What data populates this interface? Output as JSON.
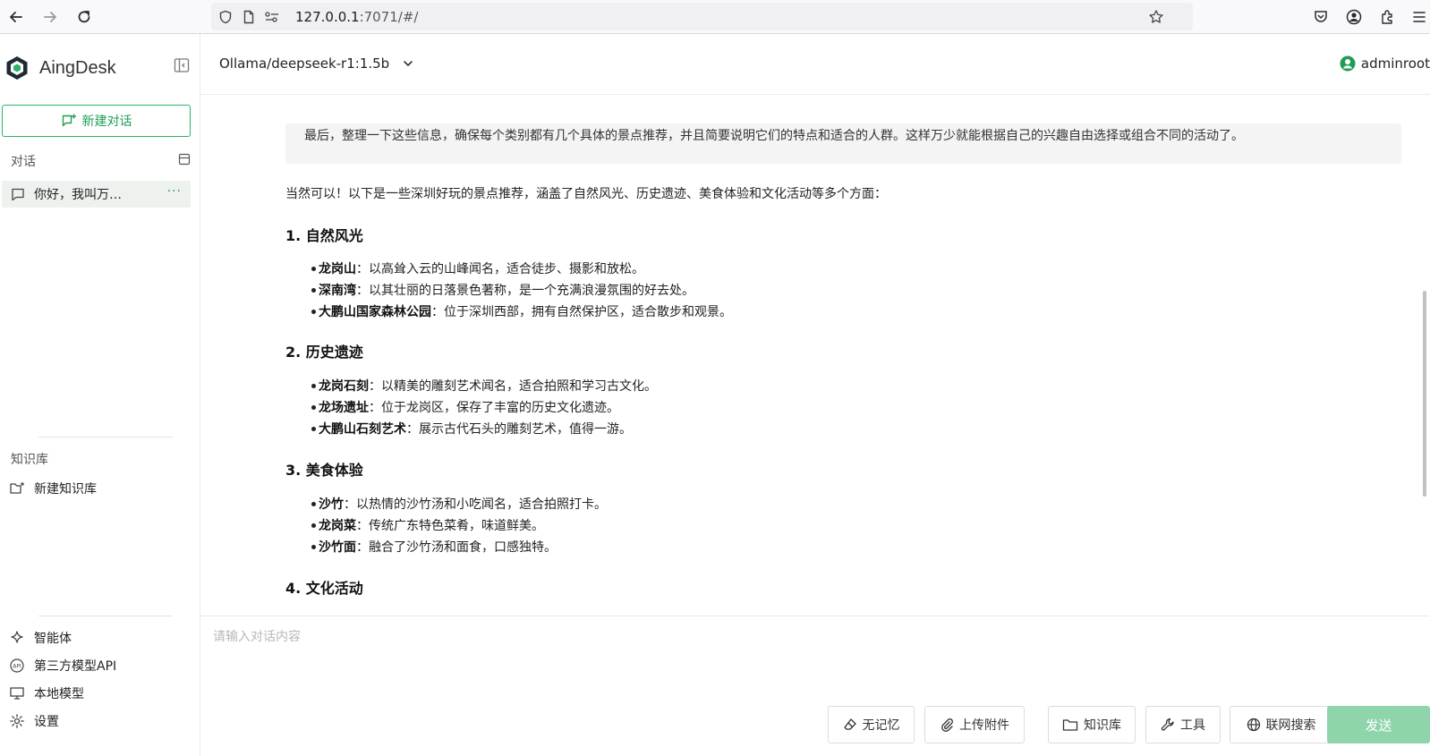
{
  "browser": {
    "url_host": "127.0.0.1",
    "url_rest": ":7071/#/"
  },
  "sidebar": {
    "brand": "AingDesk",
    "new_chat": "新建对话",
    "conversations_label": "对话",
    "conversations": [
      {
        "title": "你好，我叫万…",
        "more": "···"
      }
    ],
    "knowledge_label": "知识库",
    "new_knowledge": "新建知识库",
    "bottom_links": [
      {
        "label": "智能体",
        "icon": "sparkle-icon"
      },
      {
        "label": "第三方模型API",
        "icon": "api-icon"
      },
      {
        "label": "本地模型",
        "icon": "monitor-icon"
      },
      {
        "label": "设置",
        "icon": "gear-icon"
      }
    ]
  },
  "topbar": {
    "model": "Ollama/deepseek-r1:1.5b",
    "user": "adminroot"
  },
  "chat": {
    "thinking": "最后，整理一下这些信息，确保每个类别都有几个具体的景点推荐，并且简要说明它们的特点和适合的人群。这样万少就能根据自己的兴趣自由选择或组合不同的活动了。",
    "intro": "当然可以！以下是一些深圳好玩的景点推荐，涵盖了自然风光、历史遗迹、美食体验和文化活动等多个方面：",
    "sections": [
      {
        "heading": "1. 自然风光",
        "items": [
          {
            "name": "龙岗山",
            "desc": "：以高耸入云的山峰闻名，适合徒步、摄影和放松。"
          },
          {
            "name": "深南湾",
            "desc": "：以其壮丽的日落景色著称，是一个充满浪漫氛围的好去处。"
          },
          {
            "name": "大鹏山国家森林公园",
            "desc": "：位于深圳西部，拥有自然保护区，适合散步和观景。"
          }
        ]
      },
      {
        "heading": "2. 历史遗迹",
        "items": [
          {
            "name": "龙岗石刻",
            "desc": "：以精美的雕刻艺术闻名，适合拍照和学习古文化。"
          },
          {
            "name": "龙场遗址",
            "desc": "：位于龙岗区，保存了丰富的历史文化遗迹。"
          },
          {
            "name": "大鹏山石刻艺术",
            "desc": "：展示古代石头的雕刻艺术，值得一游。"
          }
        ]
      },
      {
        "heading": "3. 美食体验",
        "items": [
          {
            "name": "沙竹",
            "desc": "：以热情的沙竹汤和小吃闻名，适合拍照打卡。"
          },
          {
            "name": "龙岗菜",
            "desc": "：传统广东特色菜肴，味道鲜美。"
          },
          {
            "name": "沙竹面",
            "desc": "：融合了沙竹汤和面食，口感独特。"
          }
        ]
      },
      {
        "heading": "4. 文化活动",
        "items": []
      }
    ]
  },
  "input": {
    "placeholder": "请输入对话内容",
    "buttons": {
      "no_memory": "无记忆",
      "upload": "上传附件",
      "knowledge": "知识库",
      "tools": "工具",
      "web_search": "联网搜索",
      "send": "发送"
    }
  },
  "colors": {
    "accent": "#1f9d57",
    "send_disabled": "#8fd4ab"
  }
}
